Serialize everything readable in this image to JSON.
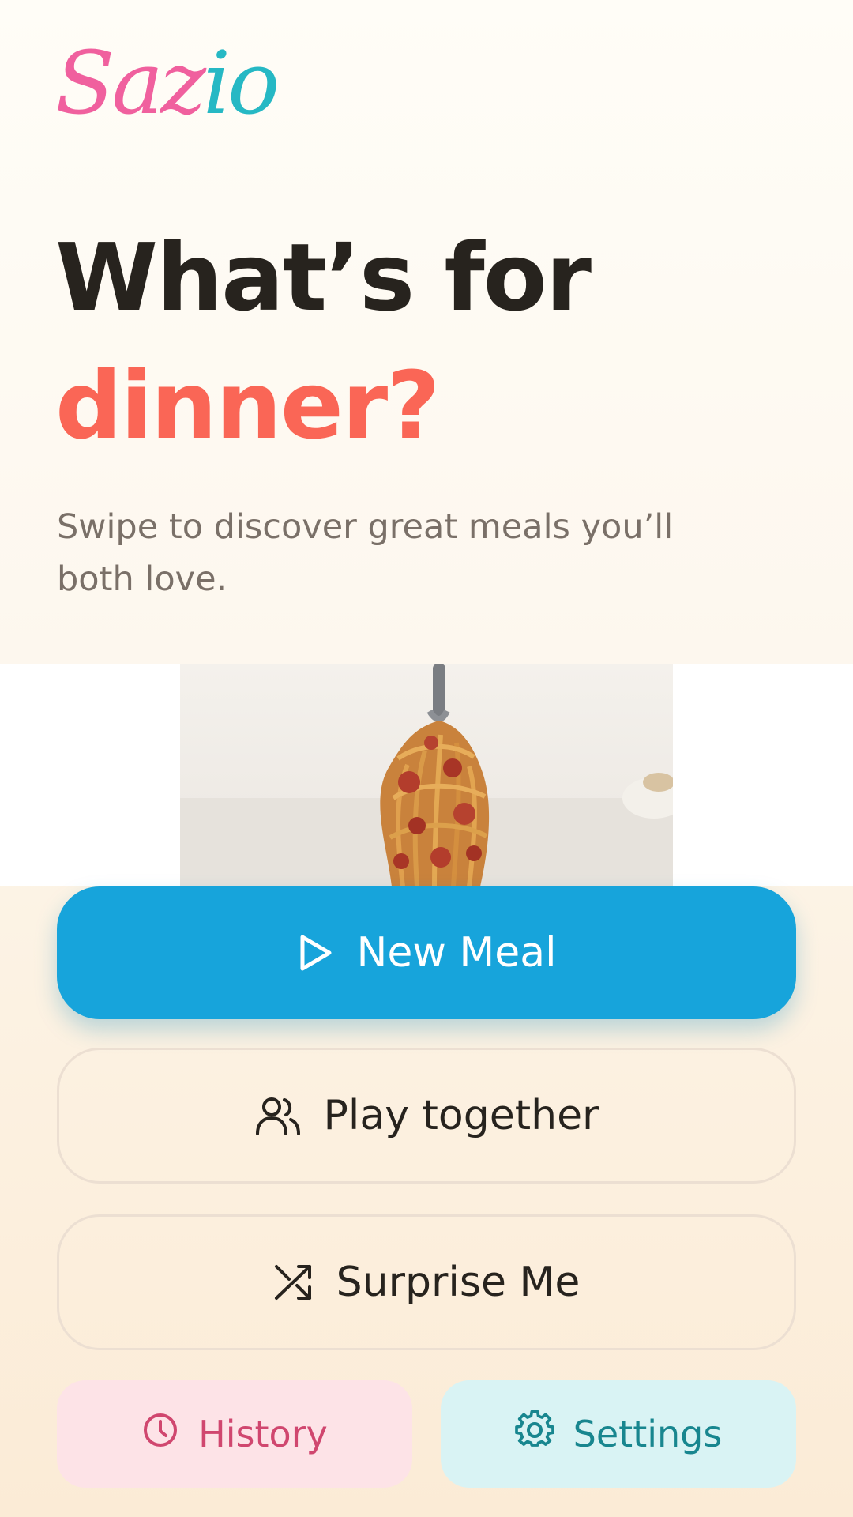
{
  "app": {
    "logo_part1": "Saz",
    "logo_part2": "io"
  },
  "hero": {
    "headline_line1": "What’s for",
    "headline_line2": "dinner?",
    "subtitle": "Swipe to discover great meals you’ll both love."
  },
  "actions": {
    "new_meal": {
      "label": "New Meal",
      "icon": "play-icon"
    },
    "play_together": {
      "label": "Play together",
      "icon": "users-icon"
    },
    "surprise_me": {
      "label": "Surprise Me",
      "icon": "shuffle-icon"
    },
    "history": {
      "label": "History",
      "icon": "clock-icon"
    },
    "settings": {
      "label": "Settings",
      "icon": "gear-icon"
    }
  },
  "colors": {
    "accent_primary": "#17a4db",
    "headline_accent": "#fa6656",
    "history_bg": "#fde3e7",
    "history_fg": "#d0476f",
    "settings_bg": "#d9f3f4",
    "settings_fg": "#18868f",
    "logo_pink": "#f0609e",
    "logo_teal": "#26b8c4"
  }
}
